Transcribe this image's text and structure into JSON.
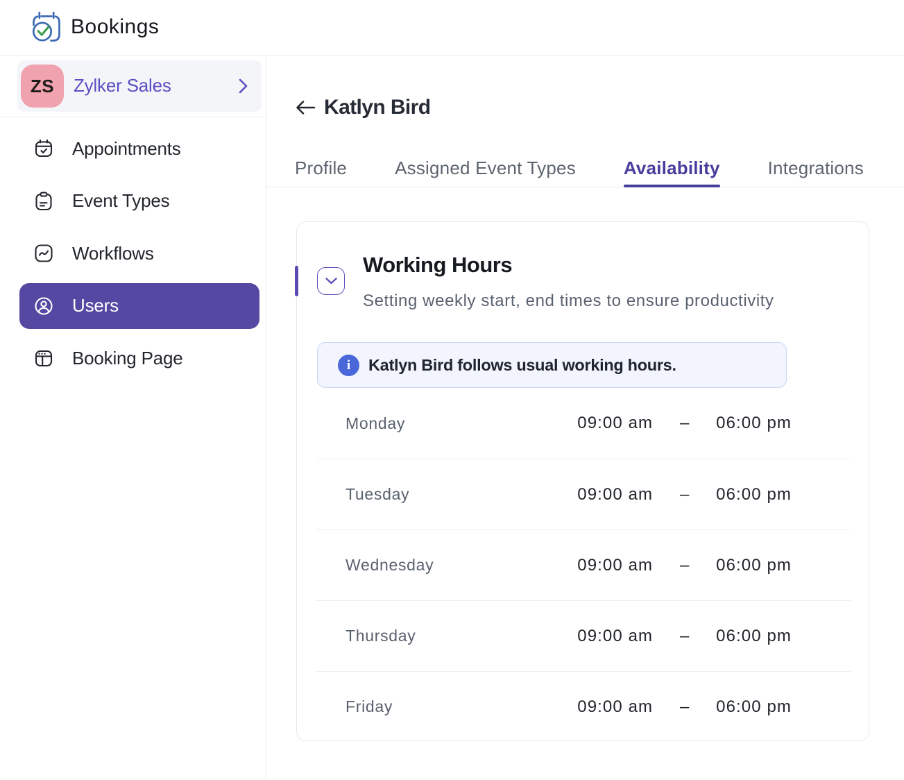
{
  "header": {
    "app_name": "Bookings",
    "logo_icon": "bookings-calendar-check-logo"
  },
  "sidebar": {
    "workspace": {
      "initials": "ZS",
      "name": "Zylker Sales",
      "chevron_icon": "chevron-right-icon"
    },
    "items": [
      {
        "label": "Appointments",
        "icon": "calendar-check-icon",
        "active": false
      },
      {
        "label": "Event Types",
        "icon": "clipboard-icon",
        "active": false
      },
      {
        "label": "Workflows",
        "icon": "workflow-pulse-icon",
        "active": false
      },
      {
        "label": "Users",
        "icon": "user-circle-icon",
        "active": true
      },
      {
        "label": "Booking Page",
        "icon": "browser-window-icon",
        "active": false
      }
    ]
  },
  "page": {
    "back_icon": "back-arrow-icon",
    "title": "Katlyn Bird",
    "tabs": [
      {
        "label": "Profile",
        "active": false
      },
      {
        "label": "Assigned Event Types",
        "active": false
      },
      {
        "label": "Availability",
        "active": true
      },
      {
        "label": "Integrations",
        "active": false
      }
    ]
  },
  "working_hours": {
    "collapse_icon": "chevron-down-icon",
    "title": "Working Hours",
    "subtitle": "Setting weekly start, end times to ensure productivity",
    "banner": {
      "icon": "info-icon",
      "icon_glyph": "i",
      "text": "Katlyn Bird follows usual working hours."
    },
    "schedule": [
      {
        "day": "Monday",
        "start": "09:00 am",
        "separator": "–",
        "end": "06:00 pm"
      },
      {
        "day": "Tuesday",
        "start": "09:00 am",
        "separator": "–",
        "end": "06:00 pm"
      },
      {
        "day": "Wednesday",
        "start": "09:00 am",
        "separator": "–",
        "end": "06:00 pm"
      },
      {
        "day": "Thursday",
        "start": "09:00 am",
        "separator": "–",
        "end": "06:00 pm"
      },
      {
        "day": "Friday",
        "start": "09:00 am",
        "separator": "–",
        "end": "06:00 pm"
      }
    ]
  },
  "colors": {
    "accent_purple": "#5448a2",
    "tab_active_purple": "#473d9c",
    "workspace_name_purple": "#5950c5",
    "avatar_pink": "#f0a3ae",
    "banner_bg": "#f2f5fd",
    "banner_border": "#cad5f3",
    "info_icon_blue": "#4a67d9",
    "logo_blue": "#3e6cb3",
    "logo_green": "#3f9e4d"
  }
}
